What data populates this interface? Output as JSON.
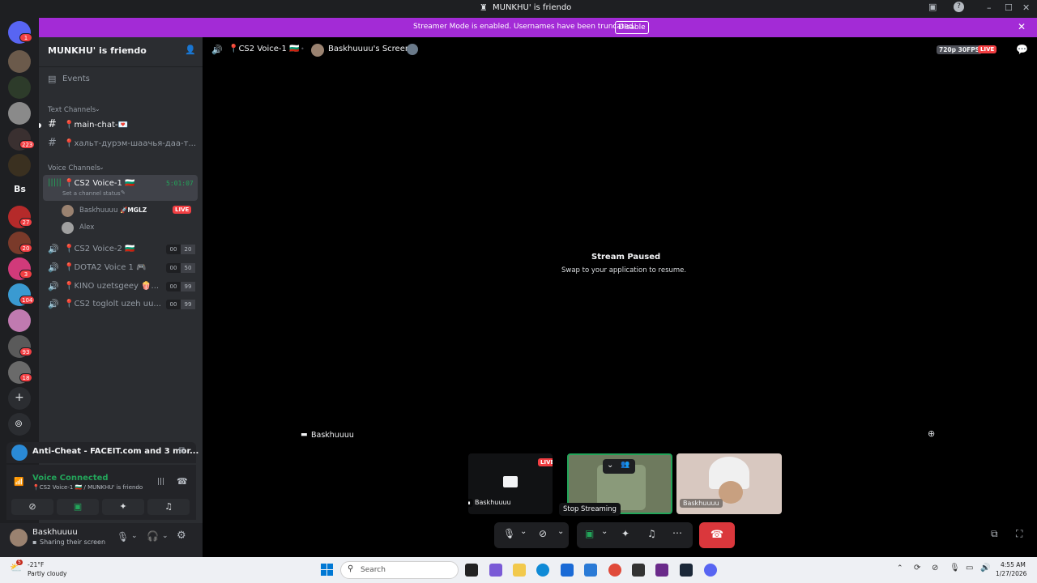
{
  "titlebar": {
    "title": "MUNKHU' is friendo"
  },
  "banner": {
    "message": "Streamer Mode is enabled. Usernames have been truncated.",
    "button": "Disable"
  },
  "guilds": [
    {
      "name": "direct-messages",
      "badge": "1",
      "color": "#5865f2"
    },
    {
      "name": "server-1",
      "badge": "",
      "color": "#6b5a4b"
    },
    {
      "name": "server-2",
      "badge": "",
      "color": "#2d3b2a"
    },
    {
      "name": "server-3",
      "badge": "",
      "color": "#8a8a8a"
    },
    {
      "name": "server-4",
      "badge": "223",
      "color": "#3a3030"
    },
    {
      "name": "server-5",
      "badge": "",
      "color": "#3a3020"
    },
    {
      "name": "server-bs",
      "badge": "",
      "color": "#1e1f22",
      "label": "Bs"
    },
    {
      "name": "server-6",
      "badge": "27",
      "color": "#b52a2a"
    },
    {
      "name": "server-7",
      "badge": "20",
      "color": "#7a3a2a"
    },
    {
      "name": "server-8",
      "badge": "3",
      "color": "#d13a7a"
    },
    {
      "name": "server-9",
      "badge": "104",
      "color": "#3a9ad1"
    },
    {
      "name": "server-10",
      "badge": "",
      "color": "#c07ab0"
    },
    {
      "name": "server-11",
      "badge": "93",
      "color": "#5a5a5a"
    },
    {
      "name": "server-12",
      "badge": "18",
      "color": "#6a6a6a"
    }
  ],
  "sidebar": {
    "server_name": "MUNKHU' is friendo",
    "events": "Events",
    "text_category": "Text Channels",
    "text_channels": [
      "📍main-chat-💌",
      "📍хальт-дурэм-шаачья-даа-т..."
    ],
    "voice_category": "Voice Channels",
    "active_voice": {
      "name": "📍CS2 Voice-1 🇧🇬",
      "status": "Set a channel status",
      "timer": "5:01:07"
    },
    "members": [
      {
        "name": "Baskhuuuu",
        "tag": "🚀MGLZ",
        "live": "LIVE"
      },
      {
        "name": "Alex",
        "tag": "",
        "live": ""
      }
    ],
    "voice_channels": [
      {
        "name": "📍CS2 Voice-2 🇧🇬",
        "a": "00",
        "b": "20"
      },
      {
        "name": "📍DOTA2 Voice 1 🎮",
        "a": "00",
        "b": "50"
      },
      {
        "name": "📍KINO uzetsgeey 🍿...",
        "a": "00",
        "b": "99"
      },
      {
        "name": "📍CS2 toglolt uzeh uu...",
        "a": "00",
        "b": "99"
      }
    ]
  },
  "activity": {
    "text": "Anti-Cheat - FACEIT.com and 3 mor..."
  },
  "voice_panel": {
    "status": "Voice Connected",
    "channel": "📍CS2 Voice-1 🇧🇬 / MUNKHU' is friendo"
  },
  "user": {
    "name": "Baskhuuuu",
    "status": "Sharing their screen"
  },
  "stream_header": {
    "channel": "📍CS2 Voice-1 🇧🇬",
    "screen": "Baskhuuuu's Screen",
    "quality": "720p 30FPS",
    "live": "LIVE"
  },
  "stream": {
    "title": "Stream Paused",
    "subtitle": "Swap to your application to resume.",
    "owner": "Baskhuuuu"
  },
  "tiles": [
    {
      "name": "Baskhuuuu",
      "live": "LIVE"
    },
    {
      "name": "",
      "live": ""
    },
    {
      "name": "Baskhuuuu",
      "live": ""
    }
  ],
  "tooltip": "Stop Streaming",
  "taskbar": {
    "temp": "-21°F",
    "weather": "Partly cloudy",
    "weather_badge": "5",
    "search": "Search",
    "time": "4:55 AM",
    "date": "1/27/2026"
  }
}
